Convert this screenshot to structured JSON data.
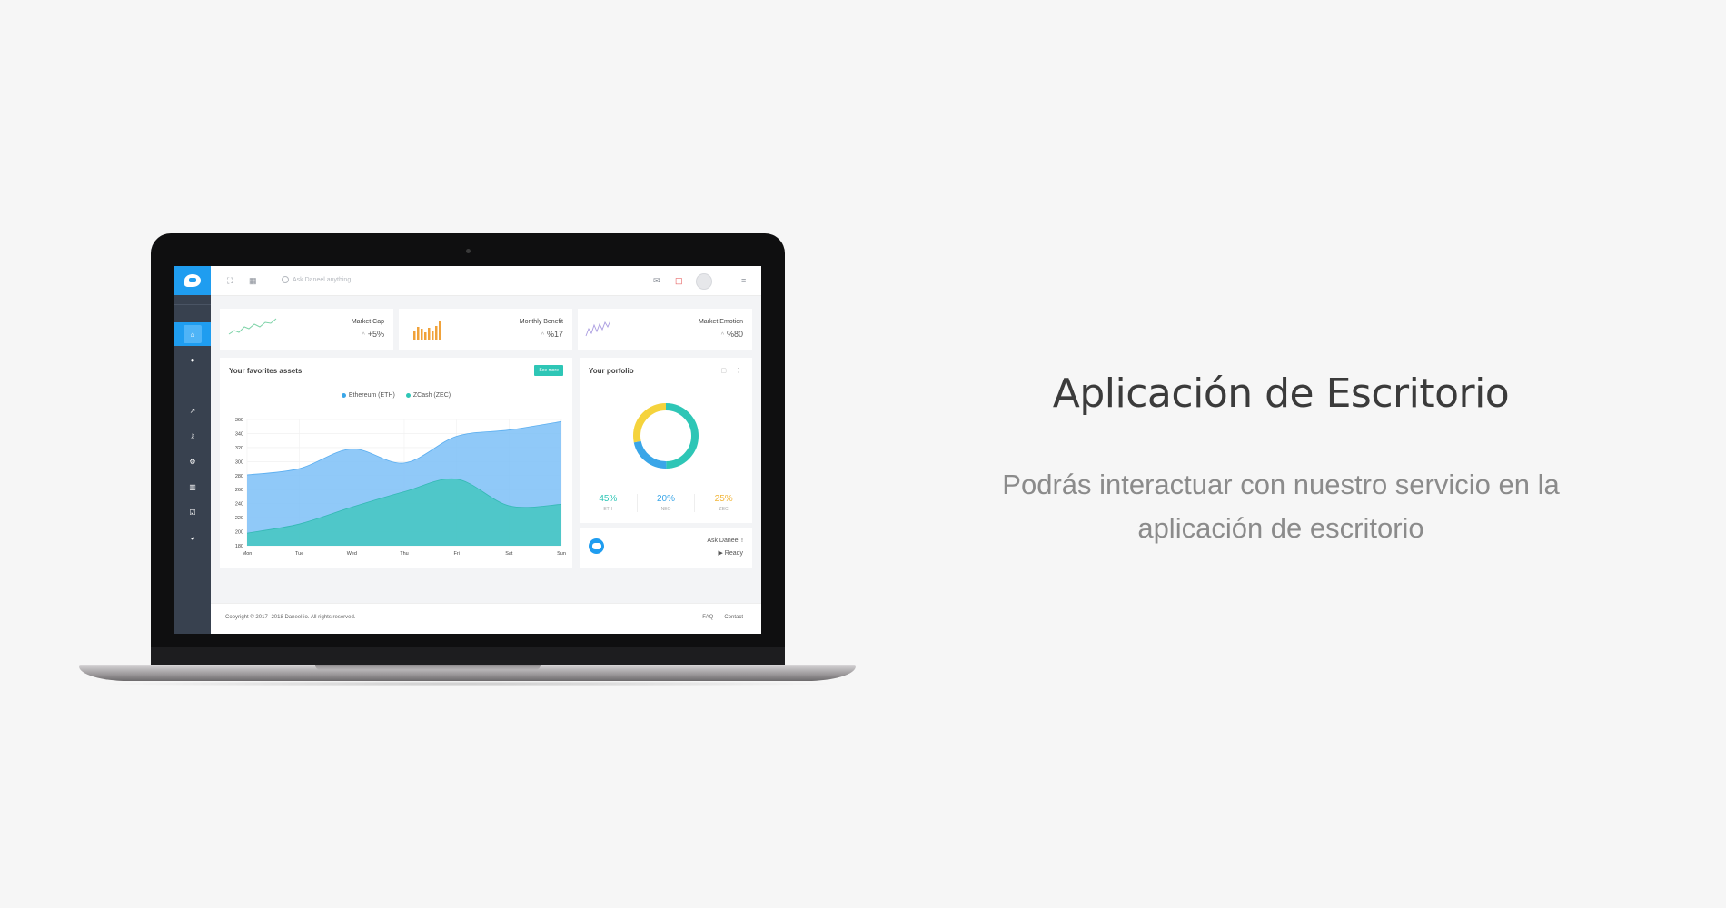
{
  "hero": {
    "heading": "Aplicación de Escritorio",
    "description": "Podrás interactuar con nuestro servicio en la aplicación de escritorio"
  },
  "app": {
    "search_placeholder": "Ask Daneel anything ...",
    "sidebar_icons": [
      "home-icon",
      "chat-icon",
      "chart-icon",
      "key-icon",
      "gears-icon",
      "book-icon",
      "check-icon",
      "pie-icon"
    ],
    "stats": [
      {
        "title": "Market Cap",
        "value": "+5%",
        "arrow": "^"
      },
      {
        "title": "Monthly Benefit",
        "value": "%17",
        "arrow": "^"
      },
      {
        "title": "Market Emotion",
        "value": "%80",
        "arrow": "^"
      }
    ],
    "assets": {
      "title": "Your favorites assets",
      "see_more": "See more",
      "legend": [
        "Ethereum (ETH)",
        "ZCash (ZEC)"
      ]
    },
    "portfolio": {
      "title": "Your porfolio",
      "items": [
        {
          "value": "45%",
          "label": "ETH",
          "color": "#2ec6b6"
        },
        {
          "value": "20%",
          "label": "NEO",
          "color": "#3aa6e8"
        },
        {
          "value": "25%",
          "label": "ZEC",
          "color": "#f2b63a"
        }
      ]
    },
    "assistant": {
      "title": "Ask Daneel !",
      "status": "Ready"
    },
    "footer": {
      "copyright": "Copyright © 2017- 2018 Daneel.io. All rights reserved.",
      "links": [
        "FAQ",
        "Contact"
      ]
    },
    "colors": {
      "accent": "#1f9df0",
      "eth": "#7cc0f7",
      "zec": "#48c7c3"
    }
  },
  "chart_data": {
    "type": "area",
    "categories": [
      "Mon",
      "Tue",
      "Wed",
      "Thu",
      "Fri",
      "Sat",
      "Sun"
    ],
    "yticks": [
      180,
      200,
      220,
      240,
      260,
      280,
      300,
      320,
      340,
      360
    ],
    "ylim": [
      180,
      360
    ],
    "series": [
      {
        "name": "Ethereum (ETH)",
        "values": [
          281,
          290,
          318,
          298,
          336,
          345,
          357
        ]
      },
      {
        "name": "ZCash (ZEC)",
        "values": [
          198,
          211,
          235,
          257,
          275,
          237,
          239
        ]
      }
    ],
    "legend_position": "top"
  }
}
